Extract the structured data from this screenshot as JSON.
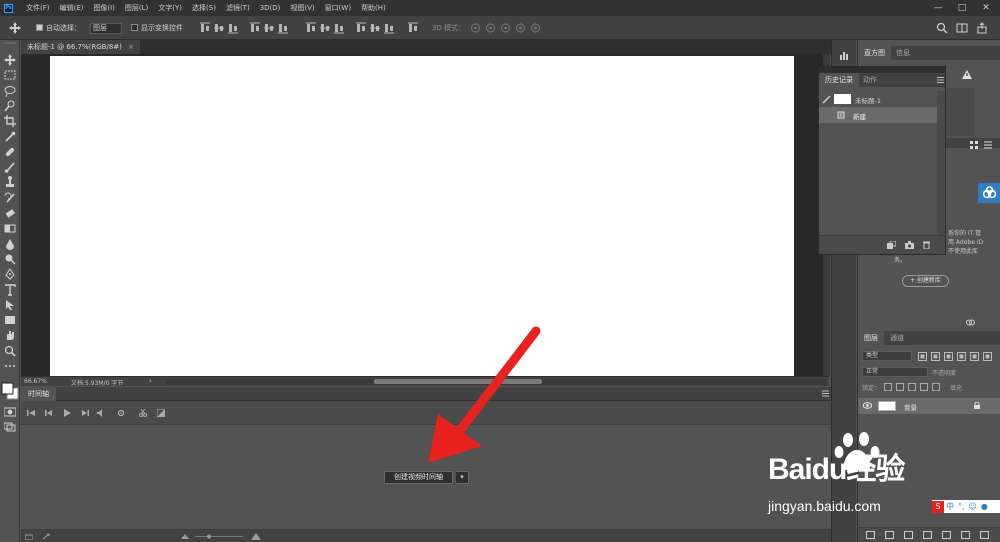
{
  "menubar": {
    "logo": "Ps",
    "items": [
      "文件(F)",
      "编辑(E)",
      "图像(I)",
      "图层(L)",
      "文字(Y)",
      "选择(S)",
      "滤镜(T)",
      "3D(D)",
      "视图(V)",
      "窗口(W)",
      "帮助(H)"
    ],
    "window_buttons": [
      "—",
      "□",
      "✕"
    ]
  },
  "options": {
    "auto_select_label": "自动选择：",
    "auto_select_value": "图层",
    "show_transform_label": "显示变换控件",
    "mode_3d_label": "3D 模式："
  },
  "document": {
    "tab_title": "未标题-1 @ 66.7%(RGB/8#)",
    "close": "×",
    "zoom": "66.67%",
    "doc_info": "文档:5.93M/0 字节"
  },
  "timeline": {
    "tab": "时间轴",
    "create_button": "创建视频时间轴"
  },
  "panels": {
    "top_tabs": [
      "直方图",
      "信息"
    ],
    "history_tabs": [
      "历史记录",
      "动作"
    ],
    "history_rows": [
      {
        "label": "未标题-1"
      },
      {
        "label": "新建"
      }
    ],
    "libraries_text_1": "系你的 IT 管",
    "libraries_text_2": "用 Adobe ID",
    "libraries_text_3": "不使用此库",
    "libraries_text_4": "务。",
    "create_library": "+ 创建新库",
    "layers_tabs": [
      "图层",
      "通道"
    ],
    "kind_label": "类型",
    "blend_mode": "正常",
    "opacity_label": "不透明度",
    "lock_label": "锁定：",
    "fill_label": "填充",
    "layer_name": "背景"
  },
  "watermark": {
    "brand": "Baidu经验",
    "url": "jingyan.baidu.com"
  },
  "ime": {
    "items": [
      "S",
      "中",
      "°,",
      "☺",
      "🎤"
    ]
  },
  "colors": {
    "annotation_arrow": "#e8231f",
    "canvas": "#ffffff",
    "selected_row": "#6a6a6a",
    "baidu_blue": "#2f7ec8"
  }
}
